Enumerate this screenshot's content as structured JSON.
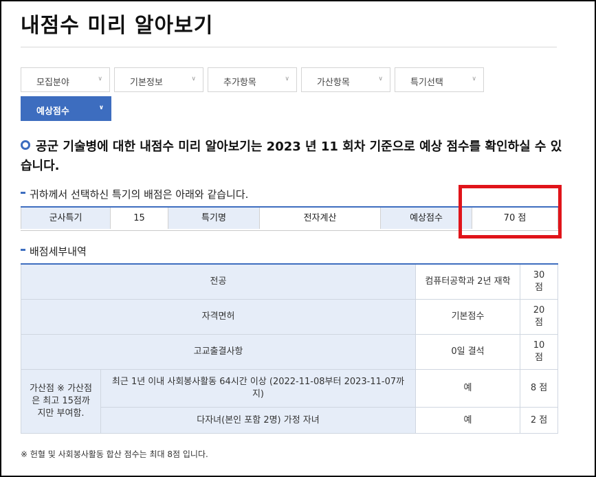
{
  "page": {
    "title": "내점수 미리 알아보기"
  },
  "tabs": [
    {
      "label": "모집분야",
      "chevron": "chevron-down-icon"
    },
    {
      "label": "기본정보",
      "chevron": "chevron-down-icon"
    },
    {
      "label": "추가항목",
      "chevron": "chevron-down-icon"
    },
    {
      "label": "가산항목",
      "chevron": "chevron-down-icon"
    },
    {
      "label": "특기선택",
      "chevron": "chevron-down-icon"
    },
    {
      "label": "예상점수",
      "chevron": "chevron-down-icon",
      "active": true
    }
  ],
  "notice": {
    "text": "공군 기술병에 대한 내점수 미리 알아보기는 2023 년 11 회차 기준으로 예상 점수를 확인하실 수 있습니다."
  },
  "summary": {
    "heading": "귀하께서 선택하신 특기의 배점은 아래와 같습니다.",
    "specialty_label": "군사특기",
    "specialty_value": "15",
    "name_label": "특기명",
    "name_value": "전자계산",
    "score_label": "예상점수",
    "score_value": "70 점"
  },
  "detail": {
    "heading": "배점세부내역",
    "rows": [
      {
        "item": "전공",
        "detail": "컴퓨터공학과 2년 재학",
        "score": "30 점"
      },
      {
        "item": "자격면허",
        "detail": "기본점수",
        "score": "20 점"
      },
      {
        "item": "고교출결사항",
        "detail": "0일 결석",
        "score": "10 점"
      }
    ],
    "bonus": {
      "label": "가산점 ※ 가산점은 최고 15점까지만 부여함.",
      "rows": [
        {
          "item": "최근 1년 이내 사회봉사활동 64시간 이상 (2022-11-08부터 2023-11-07까지)",
          "detail": "예",
          "score": "8 점"
        },
        {
          "item": "다자녀(본인 포함 2명) 가정 자녀",
          "detail": "예",
          "score": "2 점"
        }
      ]
    }
  },
  "footnote": "※ 헌혈 및 사회봉사활동 합산 점수는 최대 8점 입니다.",
  "colors": {
    "accent": "#3d6dbf",
    "highlight": "#e0141a",
    "header_bg": "#e6edf8"
  }
}
